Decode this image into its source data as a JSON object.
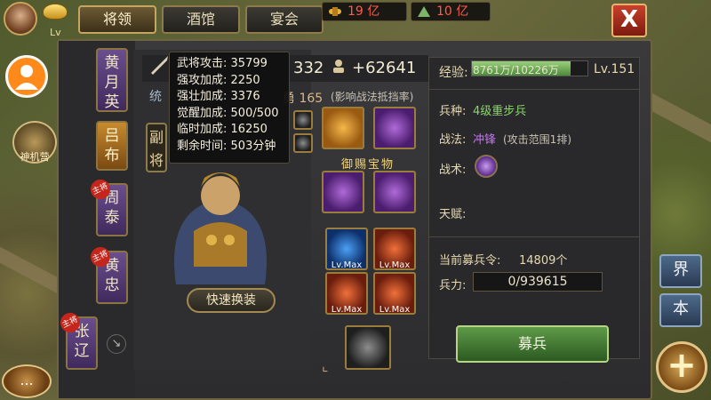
{
  "header": {
    "player_level_prefix": "Lv",
    "tabs": [
      {
        "label": "将领",
        "active": true
      },
      {
        "label": "酒馆",
        "active": false
      },
      {
        "label": "宴会",
        "active": false
      }
    ],
    "resources": [
      {
        "icon": "scroll-icon",
        "value": "19 亿"
      },
      {
        "icon": "food-icon",
        "value": "10 亿"
      }
    ],
    "close_label": "X"
  },
  "left_sidebar": {
    "shenji_label": "神机营",
    "heroes": [
      {
        "name": "黄月英",
        "main": false,
        "active": false
      },
      {
        "name": "吕布",
        "main": false,
        "active": true
      },
      {
        "name": "周泰",
        "main": true,
        "active": false
      },
      {
        "name": "黄忠",
        "main": true,
        "active": false
      },
      {
        "name": "张辽",
        "main": true,
        "active": false
      }
    ],
    "main_badge": "主将"
  },
  "hero": {
    "deputy_label": "副将",
    "quick_equip_label": "快速换装",
    "power_partial": "332",
    "power_bonus": "+62641",
    "stat_partial_label": "统",
    "courage_label": "勇 165",
    "courage_note": "(影响战法抵挡率)"
  },
  "tooltip": {
    "rows": [
      {
        "label": "武将攻击:",
        "value": "35799"
      },
      {
        "label": "强攻加成:",
        "value": "2250"
      },
      {
        "label": "强壮加成:",
        "value": "3376"
      },
      {
        "label": "觉醒加成:",
        "value": "500/500"
      },
      {
        "label": "临时加成:",
        "value": "16250"
      },
      {
        "label": "剩余时间:",
        "value": "503分钟"
      }
    ]
  },
  "equipment": {
    "royal_label": "御赐宝物",
    "lv_max": "Lv.Max"
  },
  "detail": {
    "exp_label": "经验:",
    "exp_value": "8761万/10226万",
    "exp_fraction": 0.857,
    "level": "Lv.151",
    "unit_label": "兵种:",
    "unit_value": "4级重步兵",
    "tactic_label": "战法:",
    "tactic_value": "冲锋",
    "tactic_note": "(攻击范围1排)",
    "skill_label": "战术:",
    "talent_label": "天赋:",
    "recruit_label": "当前募兵令:",
    "recruit_value": "14809个",
    "troop_label": "兵力:",
    "troop_value": "0/939615",
    "recruit_button": "募兵"
  },
  "side": {
    "world_label": "界",
    "base_label": "本",
    "plus_label": "+",
    "chat_label": "..."
  },
  "colors": {
    "accent_gold": "#c7a55e",
    "exp_green": "#9bd17a",
    "tactic_purple": "#c677f0",
    "unit_green": "#8bd46a"
  }
}
